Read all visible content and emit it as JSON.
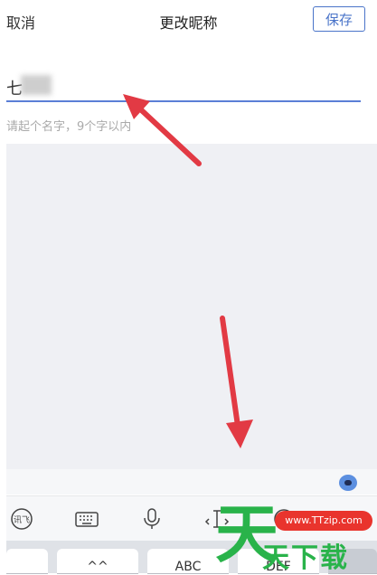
{
  "header": {
    "cancel": "取消",
    "title": "更改昵称",
    "save": "保存"
  },
  "nickname": {
    "value": "七",
    "hint": "请起个名字，9个字以内"
  },
  "toolbar": {
    "handwriting": "讯飞",
    "items": [
      "keyboard-icon",
      "microphone-icon",
      "cursor-icon"
    ]
  },
  "keyboard": {
    "keys": [
      "",
      "^^",
      "ABC",
      "DEF",
      ""
    ]
  },
  "watermark": {
    "brand": "天",
    "url": "www.TTzip.com",
    "text": "天下载"
  },
  "colors": {
    "accent": "#4a74c9",
    "arrow": "#e23a44",
    "watermark_green": "#29b34a",
    "watermark_red": "#e9342d"
  }
}
